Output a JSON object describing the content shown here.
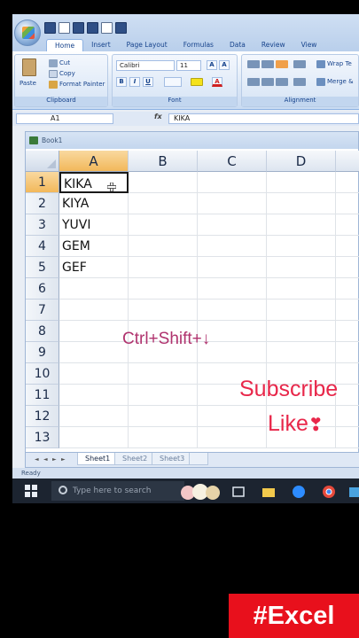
{
  "ribbon": {
    "tabs": [
      "Home",
      "Insert",
      "Page Layout",
      "Formulas",
      "Data",
      "Review",
      "View"
    ],
    "active_tab": "Home",
    "clipboard": {
      "paste": "Paste",
      "cut": "Cut",
      "copy": "Copy",
      "format_painter": "Format Painter",
      "label": "Clipboard"
    },
    "font": {
      "name": "Calibri",
      "size": "11",
      "bold": "B",
      "italic": "I",
      "underline": "U",
      "grow": "A",
      "font_color": "A",
      "label": "Font"
    },
    "alignment": {
      "wrap": "Wrap Te",
      "merge": "Merge &",
      "label": "Alignment"
    }
  },
  "formula_bar": {
    "cell_ref": "A1",
    "fx": "fx",
    "content": "KIKA"
  },
  "workbook": {
    "title": "Book1",
    "columns": [
      "A",
      "B",
      "C",
      "D"
    ],
    "rows": [
      "1",
      "2",
      "3",
      "4",
      "5",
      "6",
      "7",
      "8",
      "9",
      "10",
      "11",
      "12",
      "13"
    ],
    "cells_a": [
      "KIKA",
      "KIYA",
      "YUVI",
      "GEM",
      "GEF"
    ],
    "sheets": [
      "Sheet1",
      "Sheet2",
      "Sheet3"
    ]
  },
  "status": {
    "text": "Ready"
  },
  "taskbar": {
    "search_placeholder": "Type here to search"
  },
  "overlay": {
    "hint": "Ctrl+Shift+↓",
    "subscribe": "Subscribe",
    "like": "Like",
    "heart": "❣",
    "badge": "#Excel"
  },
  "colors": {
    "accent": "#f2b85a",
    "badge": "#e8101c",
    "subscribe": "#e8274a",
    "hint": "#b0336e"
  }
}
